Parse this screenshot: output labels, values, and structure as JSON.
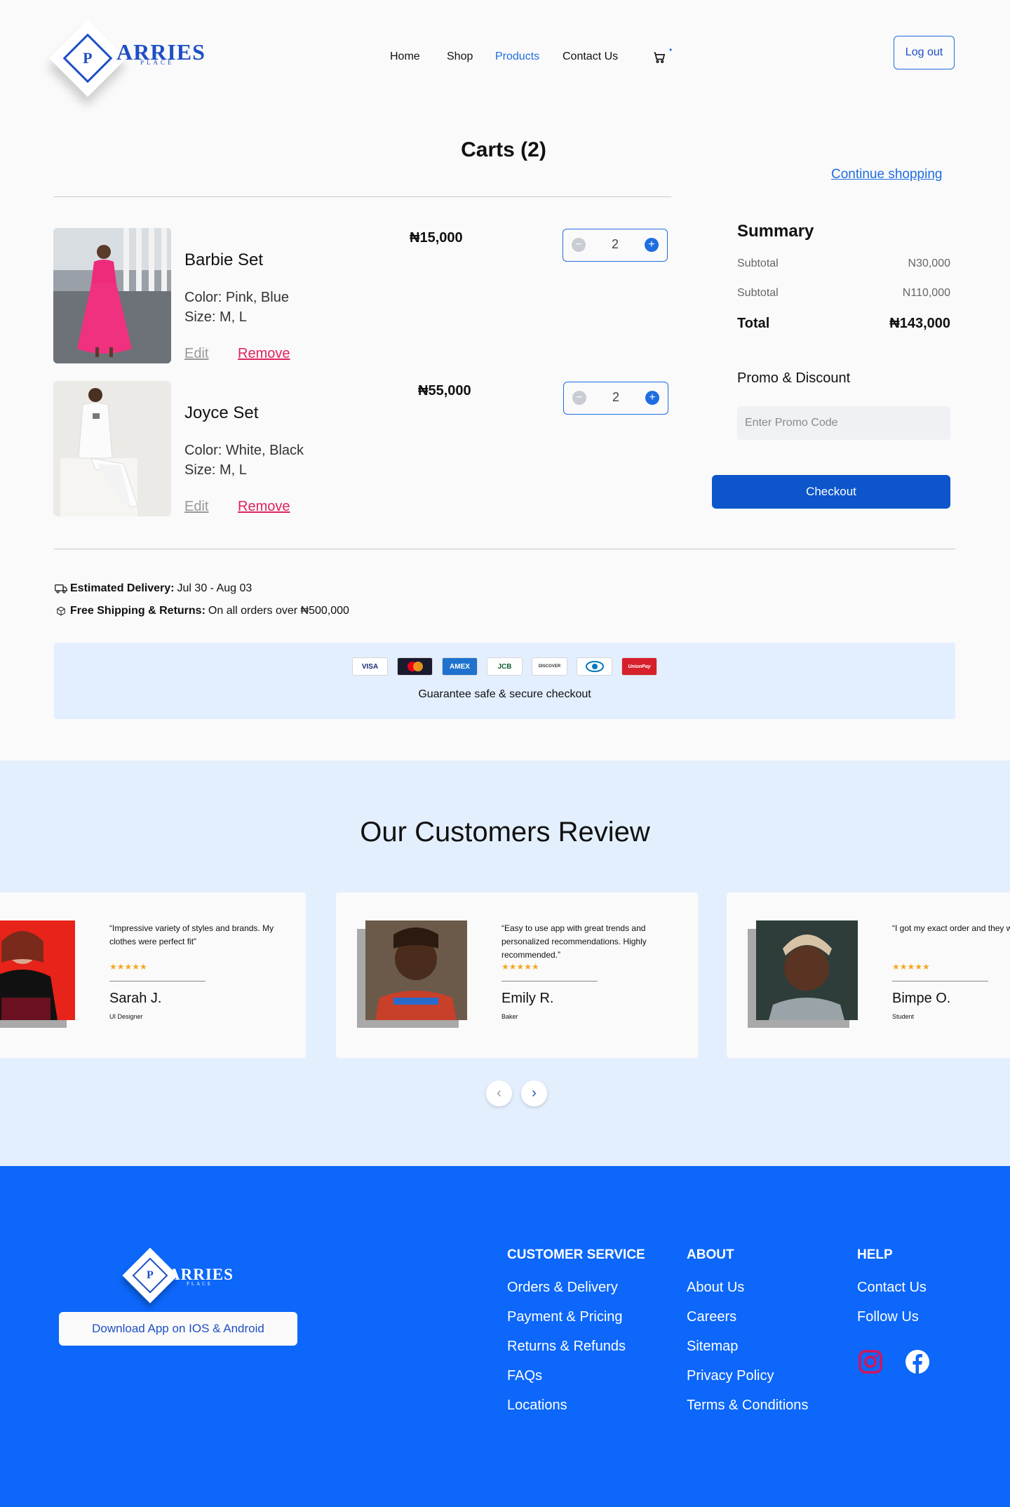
{
  "brand": {
    "name": "ARRIES",
    "sub": "PLACE",
    "mark": "P"
  },
  "nav": {
    "home": "Home",
    "shop": "Shop",
    "products": "Products",
    "contact": "Contact Us",
    "logout": "Log out",
    "cart_dot": "•"
  },
  "cart": {
    "title": "Carts (2)",
    "continue": "Continue shopping",
    "items": [
      {
        "name": "Barbie Set",
        "color": "Color: Pink, Blue",
        "size": "Size: M, L",
        "edit": "Edit",
        "remove": "Remove",
        "price": "₦15,000",
        "qty": "2"
      },
      {
        "name": "Joyce Set",
        "color": "Color: White, Black",
        "size": "Size: M, L",
        "edit": "Edit",
        "remove": "Remove",
        "price": "₦55,000",
        "qty": "2"
      }
    ]
  },
  "summary": {
    "title": "Summary",
    "rows": [
      {
        "label": "Subtotal",
        "value": "N30,000"
      },
      {
        "label": "Subtotal",
        "value": "N110,000"
      }
    ],
    "total_label": "Total",
    "total_value": "₦143,000",
    "promo_title": "Promo & Discount",
    "promo_placeholder": "Enter Promo Code",
    "checkout": "Checkout"
  },
  "delivery": {
    "est_label": "Estimated Delivery:",
    "est_value": "Jul 30 - Aug 03",
    "ship_label": "Free Shipping & Returns:",
    "ship_value": "On all orders over ₦500,000"
  },
  "payments": {
    "cards": [
      "VISA",
      "MC",
      "AMEX",
      "JCB",
      "DISCOVER",
      "DINERS",
      "UnionPay"
    ],
    "text": "Guarantee safe & secure checkout"
  },
  "reviews": {
    "title": "Our Customers Review",
    "items": [
      {
        "quote": "“Impressive variety of styles and brands. My clothes were perfect fit”",
        "stars": "★★★★★",
        "name": "Sarah J.",
        "role": "UI Designer"
      },
      {
        "quote": "“Easy to use app with great trends and personalized recommendations. Highly recommended.”",
        "stars": "★★★★★",
        "name": "Emily R.",
        "role": "Baker"
      },
      {
        "quote": "“I got my exact order and they were perfect fit”",
        "stars": "★★★★★",
        "name": "Bimpe O.",
        "role": "Student"
      }
    ],
    "prev": "‹",
    "next": "›"
  },
  "footer": {
    "app_button": "Download App on IOS & Android",
    "customer_service": {
      "title": "CUSTOMER SERVICE",
      "links": [
        "Orders & Delivery",
        "Payment & Pricing",
        "Returns & Refunds",
        "FAQs",
        "Locations"
      ]
    },
    "about": {
      "title": "ABOUT",
      "links": [
        "About Us",
        "Careers",
        "Sitemap",
        "Privacy Policy",
        "Terms & Conditions"
      ]
    },
    "help": {
      "title": "HELP",
      "links": [
        "Contact Us",
        "Follow Us"
      ]
    }
  },
  "colors": {
    "primary": "#0d55cb",
    "accent": "#1f6de0",
    "footer_bg": "#0c67fa",
    "remove": "#e0245e",
    "review_bg": "#e3effd",
    "star": "#f5a623"
  },
  "icons": [
    "cart-icon",
    "minus-icon",
    "plus-icon",
    "truck-icon",
    "box-icon",
    "chevron-left-icon",
    "chevron-right-icon",
    "instagram-icon",
    "facebook-icon"
  ]
}
